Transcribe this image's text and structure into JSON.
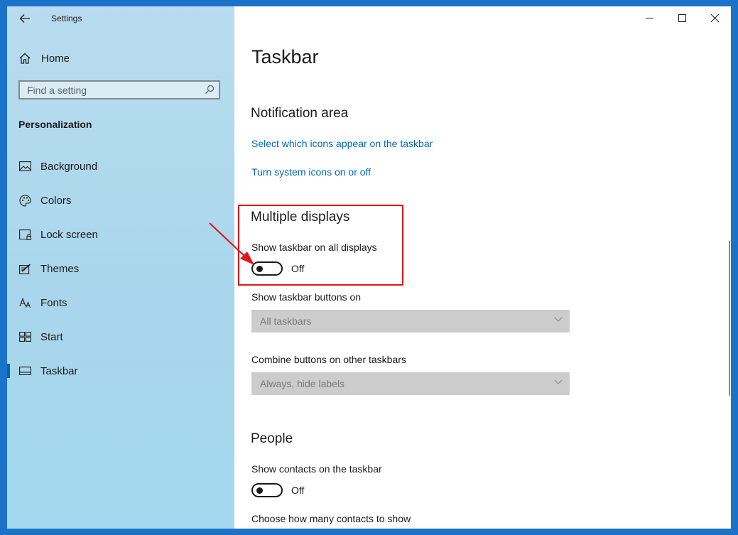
{
  "app": {
    "title": "Settings"
  },
  "sidebar": {
    "home_label": "Home",
    "search_placeholder": "Find a setting",
    "section_title": "Personalization",
    "items": [
      {
        "label": "Background",
        "icon": "picture-icon"
      },
      {
        "label": "Colors",
        "icon": "palette-icon"
      },
      {
        "label": "Lock screen",
        "icon": "lock-screen-icon"
      },
      {
        "label": "Themes",
        "icon": "themes-icon"
      },
      {
        "label": "Fonts",
        "icon": "fonts-icon"
      },
      {
        "label": "Start",
        "icon": "start-icon"
      },
      {
        "label": "Taskbar",
        "icon": "taskbar-icon",
        "active": true
      }
    ]
  },
  "main": {
    "page_title": "Taskbar",
    "notification_area": {
      "heading": "Notification area",
      "link1": "Select which icons appear on the taskbar",
      "link2": "Turn system icons on or off"
    },
    "multiple_displays": {
      "heading": "Multiple displays",
      "show_all_label": "Show taskbar on all displays",
      "show_all_state": "Off",
      "buttons_on_label": "Show taskbar buttons on",
      "buttons_on_value": "All taskbars",
      "combine_label": "Combine buttons on other taskbars",
      "combine_value": "Always, hide labels"
    },
    "people": {
      "heading": "People",
      "contacts_label": "Show contacts on the taskbar",
      "contacts_state": "Off",
      "how_many_label": "Choose how many contacts to show"
    }
  },
  "colors": {
    "accent": "#0067c0",
    "highlight": "#e01717",
    "desktop": "#1a73c9",
    "sidebar": "#a9d6ec"
  }
}
